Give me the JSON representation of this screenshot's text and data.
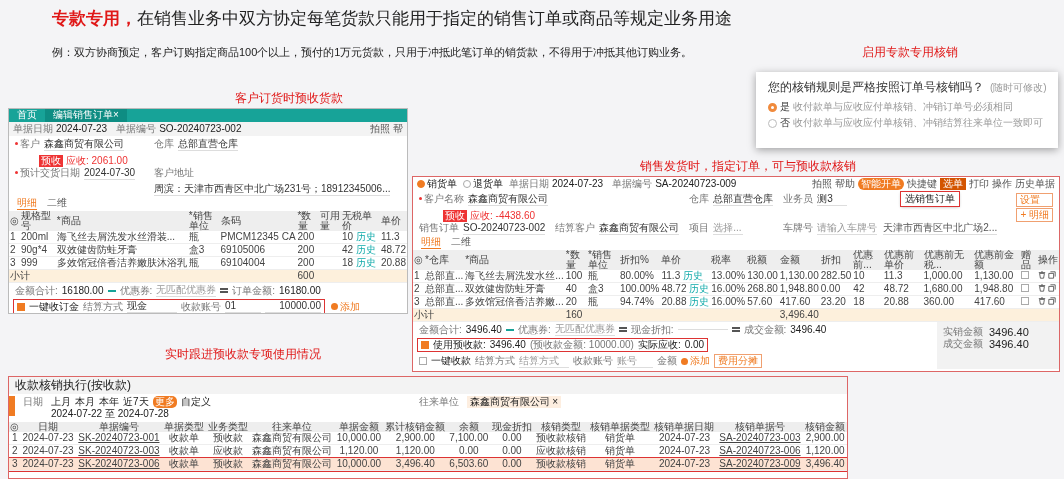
{
  "heading": {
    "emphasis": "专款专用，",
    "text": "在销售业务中双方协定每笔货款只能用于指定的销售订单或商品等规定业务用途"
  },
  "example": "例：双方协商预定，客户订购指定商品100个以上，预付的1万元货款，只用于冲抵此笔订单的销货款，不得用于冲抵其他订购业务。",
  "enable_label": "启用专款专用核销",
  "rule_popup": {
    "question": "您的核销规则是严格按照订单号核销吗？",
    "hint": "(随时可修改)",
    "options": [
      {
        "label": "是",
        "description": "收付款单与应收应付单核销、冲销订单号必须相同",
        "selected": true
      },
      {
        "label": "否",
        "description": "收付款单与应收应付单核销、冲销结算往来单位一致即可",
        "selected": false
      }
    ]
  },
  "order_screen": {
    "caption": "客户订货时预收货款",
    "tabs": [
      {
        "label": "首页",
        "selected": false
      },
      {
        "label": "编辑销售订单",
        "close": "×",
        "selected": true
      }
    ],
    "header": [
      {
        "label": "单据日期",
        "value": "2024-07-23"
      },
      {
        "label": "单据编号",
        "value": "SO-20240723-002"
      }
    ],
    "toolbar": [
      "拍照",
      "帮"
    ],
    "fields": [
      {
        "label": "客户",
        "value": "森鑫商贸有限公司",
        "required": true
      },
      {
        "label": "仓库",
        "value": "总部直营仓库",
        "required": false
      },
      {
        "label": "预计交货日期",
        "value": "2024-07-30",
        "required": true
      },
      {
        "label": "客户地址",
        "value": "周滨：天津市西青区中北广场231号；18912345006...",
        "required": false
      }
    ],
    "badge": "预收",
    "balance": "应收: 2061.00",
    "detail_tabs": [
      {
        "label": "明细",
        "selected": true
      },
      {
        "label": "二维",
        "selected": false
      }
    ],
    "table": {
      "columns": [
        "◎",
        "规格型号",
        "*商品",
        "*销售单位",
        "条码",
        "*数量",
        "可用量",
        "无税单价",
        "单价"
      ],
      "rows": [
        {
          "cells": [
            "1",
            "200ml",
            "海飞丝去屑洗发水丝滑装...",
            "瓶",
            "PMCM12345 CA",
            "200",
            "",
            {
              "text": "10",
              "link": "历史"
            },
            "11.3"
          ]
        },
        {
          "cells": [
            "2",
            "90g*4",
            "双效健齿防蛀牙膏",
            "盒3",
            "69105006",
            "200",
            "",
            {
              "text": "42",
              "link": "历史"
            },
            "48.72"
          ]
        },
        {
          "cells": [
            "3",
            "999",
            "多效馆冠倍香洁养嫩肤沐浴乳",
            "瓶",
            "69104004",
            "200",
            "",
            {
              "text": "18",
              "link": "历史"
            },
            "20.88"
          ]
        }
      ],
      "total": {
        "label": "小计",
        "quantity": "600"
      }
    },
    "totals": {
      "sum_label": "金额合计:",
      "sum": "16180.00",
      "coupon_label": "优惠券:",
      "coupon_placeholder": "无匹配优惠券",
      "order_label": "订单金额:",
      "order": "16180.00"
    },
    "deposit": {
      "checked": true,
      "highlighted": true,
      "label": "一键收订金",
      "method_label": "结算方式",
      "method": "现金",
      "account_label": "收款账号",
      "account": "01",
      "amount": "10000.00",
      "add": "添加"
    }
  },
  "delivery_screen": {
    "caption": "销售发货时，指定订单，可与预收款核销",
    "doc_types": [
      {
        "label": "销货单",
        "selected": true
      },
      {
        "label": "退货单",
        "selected": false
      }
    ],
    "header": [
      {
        "label": "单据日期",
        "value": "2024-07-23"
      },
      {
        "label": "单据编号",
        "value": "SA-20240723-009"
      }
    ],
    "toolbar": [
      {
        "label": "拍照",
        "kind": "plain"
      },
      {
        "label": "帮助",
        "kind": "plain"
      },
      {
        "label": "智能开单",
        "kind": "primary"
      },
      {
        "label": "快捷键",
        "kind": "plain"
      },
      {
        "label": "选单",
        "kind": "active"
      },
      {
        "label": "打印",
        "kind": "plain"
      },
      {
        "label": "操作",
        "kind": "plain"
      },
      {
        "label": "历史单据",
        "kind": "plain"
      }
    ],
    "dropdown": {
      "label": "选销售订单",
      "highlighted": true
    },
    "fields": [
      {
        "label": "客户名称",
        "value": "森鑫商贸有限公司",
        "required": true
      },
      {
        "label": "仓库",
        "value": "总部直营仓库",
        "required": false
      },
      {
        "label": "业务员",
        "value": "测3",
        "required": false
      },
      {
        "label": "销售订单",
        "value": "SO-20240723-002",
        "required": false
      },
      {
        "label": "结算客户",
        "value": "森鑫商贸有限公司",
        "required": false
      },
      {
        "label": "项目",
        "placeholder": "选择...",
        "required": false
      },
      {
        "label": "车牌号",
        "placeholder": "请输入车牌号",
        "required": false
      }
    ],
    "address": "天津市西青区中北广场2...",
    "side_buttons": [
      "设置",
      "+ 明细"
    ],
    "badge": "预收",
    "balance": "应收: -4438.60",
    "detail_tabs": [
      {
        "label": "明细",
        "selected": true
      },
      {
        "label": "二维",
        "selected": false
      }
    ],
    "table": {
      "columns": [
        "◎",
        "*仓库",
        "*商品",
        "*数量",
        "*销售单位",
        "折扣%",
        "单价",
        "税率",
        "税额",
        "金额",
        "折扣",
        "优惠前...",
        "优惠前单价",
        "优惠前无税...",
        "优惠前金额",
        "赠品",
        "操作"
      ],
      "rows": [
        {
          "cells": [
            "1",
            "总部直...",
            "海飞丝去屑洗发水丝...",
            "100",
            "瓶",
            "80.00%",
            {
              "text": "11.3",
              "link": "历史"
            },
            "13.00%",
            "130.00",
            "1,130.00",
            "282.50",
            "10",
            "11.3",
            "1,000.00",
            "1,130.00",
            {
              "kind": "checkbox",
              "checked": false
            },
            {
              "kind": "actions"
            }
          ]
        },
        {
          "cells": [
            "2",
            "总部直...",
            "双效健齿防蛀牙膏",
            "40",
            "盒3",
            "100.00%",
            {
              "text": "48.72",
              "link": "历史"
            },
            "16.00%",
            "268.80",
            "1,948.80",
            "0.00",
            "42",
            "48.72",
            "1,680.00",
            "1,948.80",
            {
              "kind": "checkbox",
              "checked": false
            },
            {
              "kind": "actions"
            }
          ]
        },
        {
          "cells": [
            "3",
            "总部直...",
            "多效馆冠倍香洁养嫩...",
            "20",
            "瓶",
            "94.74%",
            {
              "text": "20.88",
              "link": "历史"
            },
            "16.00%",
            "57.60",
            "417.60",
            "23.20",
            "18",
            "20.88",
            "360.00",
            "417.60",
            {
              "kind": "checkbox",
              "checked": false
            },
            {
              "kind": "actions"
            }
          ]
        }
      ],
      "total": {
        "label": "小计",
        "quantity": "160",
        "amount": "3,496.40"
      }
    },
    "totals": {
      "sum_label": "金额合计:",
      "sum": "3496.40",
      "coupon_label": "优惠券:",
      "coupon_placeholder": "无匹配优惠券",
      "discount_label": "现金折扣:",
      "deal_label": "成交金额:",
      "deal": "3496.40"
    },
    "prepay": {
      "checked": true,
      "highlighted": true,
      "label": "使用预收款:",
      "amount": "3496.40",
      "note": "(预收款金额: 10000.00)",
      "due_label": "实际应收:",
      "due": "0.00"
    },
    "collect": {
      "checked": false,
      "label": "一键收款",
      "method_label": "结算方式",
      "method_placeholder": "结算方式",
      "account_label": "收款账号",
      "account_placeholder": "账号",
      "amount_label": "金额",
      "add": "添加",
      "share": "费用分摊"
    },
    "summary": [
      {
        "label": "实销金额",
        "value": "3496.40"
      },
      {
        "label": "成交金额",
        "value": "3496.40"
      }
    ]
  },
  "writeoff_screen": {
    "caption": "实时跟进预收款专项使用情况",
    "title": "收款核销执行(按收款)",
    "date_label": "日期",
    "presets": [
      {
        "label": "上月",
        "selected": false
      },
      {
        "label": "本月",
        "selected": false
      },
      {
        "label": "本年",
        "selected": false
      },
      {
        "label": "近7天",
        "selected": false
      },
      {
        "label": "更多",
        "selected": true
      },
      {
        "label": "自定义",
        "selected": false
      }
    ],
    "range": "2024-07-22 至 2024-07-28",
    "partner_label": "往来单位",
    "partner": "森鑫商贸有限公司",
    "partner_close": "×",
    "table": {
      "columns": [
        "◎",
        "日期",
        "单据编号",
        "单据类型",
        "业务类型",
        "往来单位",
        "单据金额",
        "累计核销金额",
        "余额",
        "现金折扣",
        "核销类型",
        "核销单据类型",
        "核销单据日期",
        "核销单据号",
        "核销金额"
      ],
      "rows": [
        {
          "highlighted": false,
          "cells": [
            "1",
            "2024-07-23",
            {
              "kind": "link",
              "text": "SK-20240723-001"
            },
            "收款单",
            "预收款",
            "森鑫商贸有限公司",
            "10,000.00",
            "2,900.00",
            "7,100.00",
            "0.00",
            "预收款核销",
            "销货单",
            "2024-07-23",
            {
              "kind": "link",
              "text": "SA-20240723-003"
            },
            "2,900.00"
          ]
        },
        {
          "highlighted": false,
          "cells": [
            "2",
            "2024-07-23",
            {
              "kind": "link",
              "text": "SK-20240723-003"
            },
            "收款单",
            "应收款",
            "森鑫商贸有限公司",
            "1,120.00",
            "1,120.00",
            "0.00",
            "0.00",
            "应收款核销",
            "销货单",
            "2024-07-23",
            {
              "kind": "link",
              "text": "SA-20240723-006"
            },
            "1,120.00"
          ]
        },
        {
          "highlighted": true,
          "cells": [
            "3",
            "2024-07-23",
            {
              "kind": "link",
              "text": "SK-20240723-006"
            },
            "收款单",
            "预收款",
            "森鑫商贸有限公司",
            "10,000.00",
            "3,496.40",
            "6,503.60",
            "0.00",
            "预收款核销",
            "销货单",
            "2024-07-23",
            {
              "kind": "link",
              "text": "SA-20240723-009"
            },
            "3,496.40"
          ]
        }
      ]
    }
  }
}
